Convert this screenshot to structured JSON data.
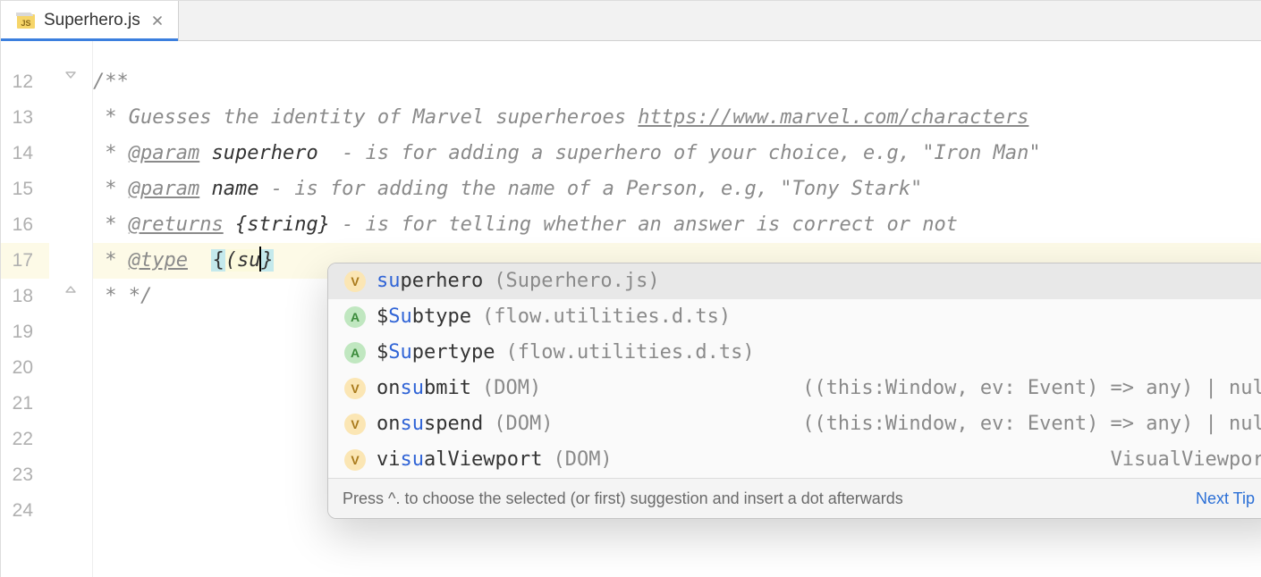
{
  "tab": {
    "filename": "Superhero.js",
    "icon": "js-icon"
  },
  "gutter": {
    "start": 12,
    "lines": [
      12,
      13,
      14,
      15,
      16,
      17,
      18,
      19,
      20,
      21,
      22,
      23,
      24
    ],
    "highlighted": 17
  },
  "code": {
    "l12_open": "/**",
    "l13_star": " * ",
    "l13_text": "Guesses the identity of Marvel superheroes ",
    "l13_url": "https://www.marvel.com/characters",
    "l14_star": " * ",
    "l14_tag": "@param",
    "l14_name": "superhero",
    "l14_rest": "  - is for adding a superhero of your choice, e.g, \"Iron Man\"",
    "l15_star": " * ",
    "l15_tag": "@param",
    "l15_name": "name",
    "l15_rest": " - is for adding the name of a Person, e.g, \"Tony Stark\"",
    "l16_star": " * ",
    "l16_tag": "@returns",
    "l16_type": "{string}",
    "l16_rest": " - is for telling whether an answer is correct or not",
    "l17_star": " * ",
    "l17_tag": "@type",
    "l17_pre": "  ",
    "l17_brace_open": "{",
    "l17_paren": "(",
    "l17_typed": "su",
    "l17_brace_close": "}",
    "l18_close": " * */"
  },
  "autocomplete": {
    "items": [
      {
        "kind": "v",
        "prefix": "",
        "match": "su",
        "rest": "perhero",
        "source": "(Superhero.js)",
        "rtype": "",
        "selected": true
      },
      {
        "kind": "a",
        "prefix": "$",
        "match": "Su",
        "rest": "btype",
        "source": "(flow.utilities.d.ts)",
        "rtype": ""
      },
      {
        "kind": "a",
        "prefix": "$",
        "match": "Su",
        "rest": "pertype",
        "source": "(flow.utilities.d.ts)",
        "rtype": ""
      },
      {
        "kind": "v",
        "prefix": "on",
        "match": "su",
        "rest": "bmit",
        "source": "(DOM)",
        "rtype": "((this:Window, ev: Event) => any) | null"
      },
      {
        "kind": "v",
        "prefix": "on",
        "match": "su",
        "rest": "spend",
        "source": "(DOM)",
        "rtype": "((this:Window, ev: Event) => any) | null"
      },
      {
        "kind": "v",
        "prefix": "vi",
        "match": "su",
        "rest": "alViewport",
        "source": "(DOM)",
        "rtype": "VisualViewport"
      }
    ],
    "footer_hint": "Press ^. to choose the selected (or first) suggestion and insert a dot afterwards",
    "footer_next": "Next Tip"
  }
}
